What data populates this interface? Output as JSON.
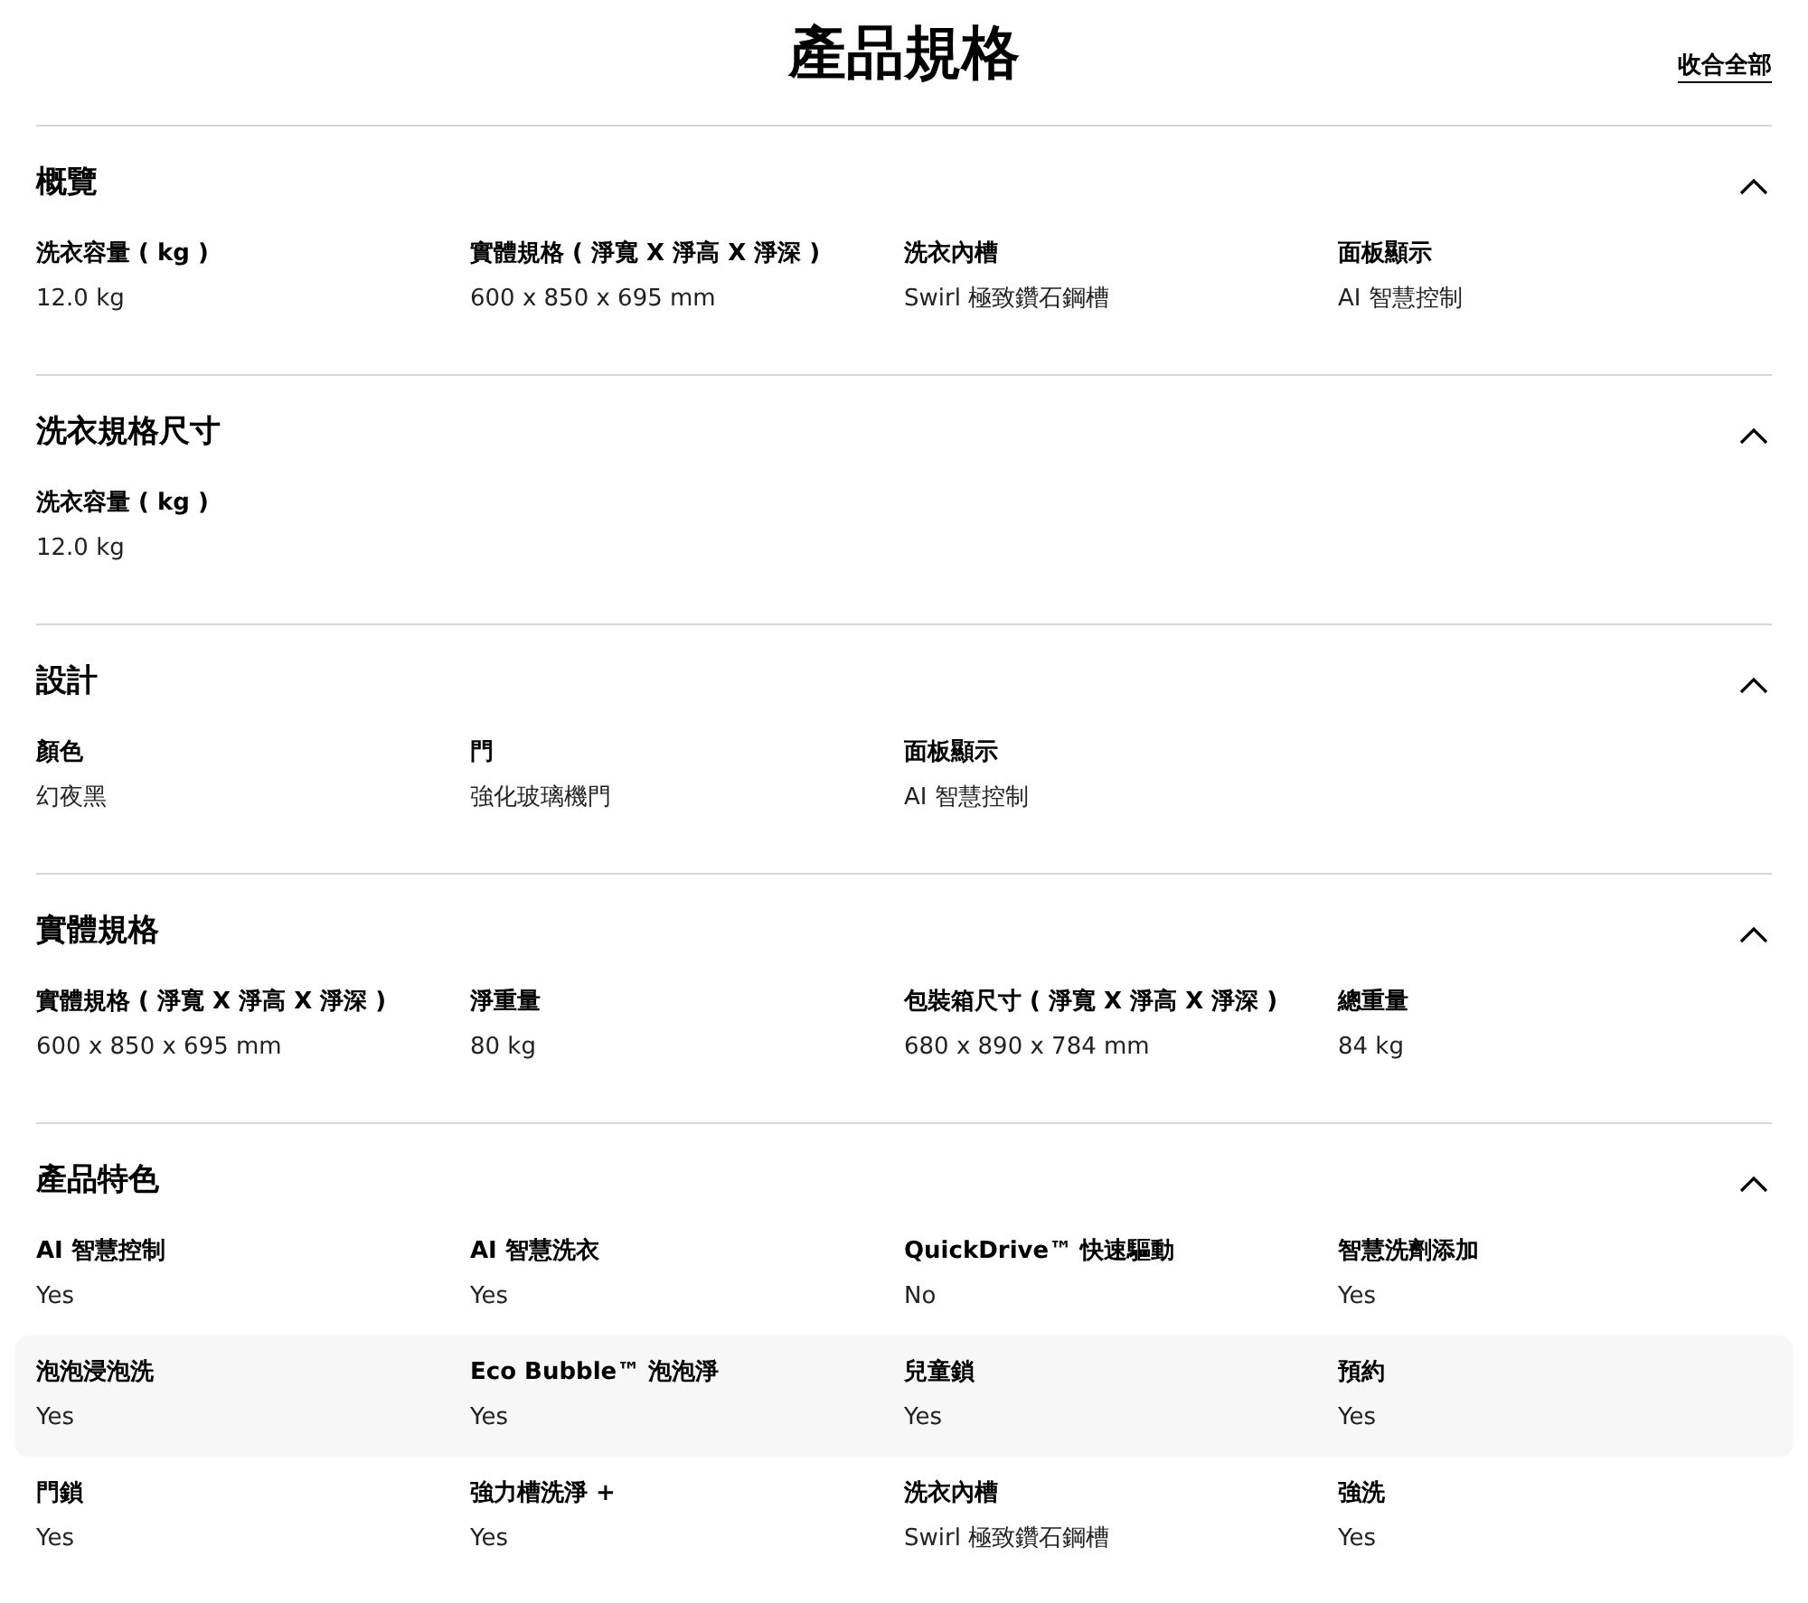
{
  "page_title": "產品規格",
  "collapse_all": "收合全部",
  "sections": [
    {
      "title": "概覽",
      "expanded": true,
      "rows": [
        {
          "highlighted": false,
          "specs": [
            {
              "label": "洗衣容量 ( kg )",
              "value": "12.0 kg"
            },
            {
              "label": "實體規格 ( 淨寬 X 淨高 X 淨深 )",
              "value": "600 x 850 x 695 mm"
            },
            {
              "label": "洗衣內槽",
              "value": "Swirl 極致鑽石鋼槽"
            },
            {
              "label": "面板顯示",
              "value": "AI 智慧控制"
            }
          ]
        }
      ]
    },
    {
      "title": "洗衣規格尺寸",
      "expanded": true,
      "rows": [
        {
          "highlighted": false,
          "specs": [
            {
              "label": "洗衣容量 ( kg )",
              "value": "12.0 kg"
            }
          ]
        }
      ]
    },
    {
      "title": "設計",
      "expanded": true,
      "rows": [
        {
          "highlighted": false,
          "specs": [
            {
              "label": "顏色",
              "value": "幻夜黑"
            },
            {
              "label": "門",
              "value": "強化玻璃機門"
            },
            {
              "label": "面板顯示",
              "value": "AI 智慧控制"
            }
          ]
        }
      ]
    },
    {
      "title": "實體規格",
      "expanded": true,
      "rows": [
        {
          "highlighted": false,
          "specs": [
            {
              "label": "實體規格 ( 淨寬 X 淨高 X 淨深 )",
              "value": "600 x 850 x 695 mm"
            },
            {
              "label": "淨重量",
              "value": "80 kg"
            },
            {
              "label": "包裝箱尺寸 ( 淨寬 X 淨高 X 淨深 )",
              "value": "680 x 890 x 784 mm"
            },
            {
              "label": "總重量",
              "value": "84 kg"
            }
          ]
        }
      ]
    },
    {
      "title": "產品特色",
      "expanded": true,
      "rows": [
        {
          "highlighted": false,
          "specs": [
            {
              "label": "AI 智慧控制",
              "value": "Yes"
            },
            {
              "label": "AI 智慧洗衣",
              "value": "Yes"
            },
            {
              "label": "QuickDrive™ 快速驅動",
              "value": "No"
            },
            {
              "label": "智慧洗劑添加",
              "value": "Yes"
            }
          ]
        },
        {
          "highlighted": true,
          "specs": [
            {
              "label": "泡泡浸泡洗",
              "value": "Yes"
            },
            {
              "label": "Eco Bubble™ 泡泡淨",
              "value": "Yes"
            },
            {
              "label": "兒童鎖",
              "value": "Yes"
            },
            {
              "label": "預約",
              "value": "Yes"
            }
          ]
        },
        {
          "highlighted": false,
          "specs": [
            {
              "label": "門鎖",
              "value": "Yes"
            },
            {
              "label": "強力槽洗淨 +",
              "value": "Yes"
            },
            {
              "label": "洗衣內槽",
              "value": "Swirl 極致鑽石鋼槽"
            },
            {
              "label": "強洗",
              "value": "Yes"
            }
          ]
        }
      ]
    }
  ]
}
